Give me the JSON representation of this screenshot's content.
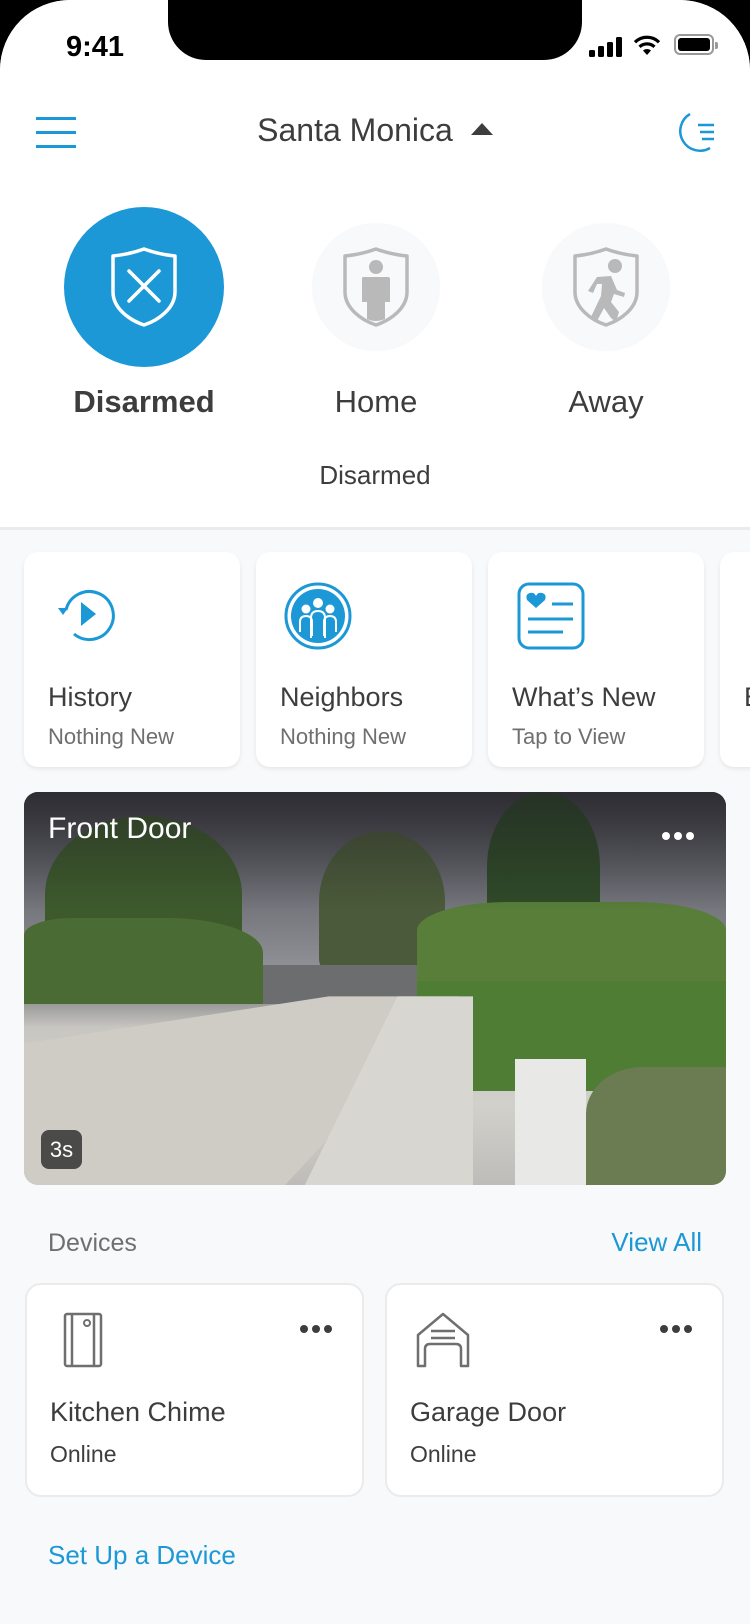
{
  "status_bar": {
    "time": "9:41",
    "icons": [
      "signal-icon",
      "wifi-icon",
      "battery-icon"
    ]
  },
  "header": {
    "location": "Santa Monica",
    "menu_icon": "hamburger-icon",
    "location_toggle_icon": "caret-up-icon",
    "mode_icon": "moon-icon"
  },
  "modes": {
    "items": [
      {
        "label": "Disarmed",
        "icon": "shield-x-icon",
        "active": true
      },
      {
        "label": "Home",
        "icon": "shield-person-icon",
        "active": false
      },
      {
        "label": "Away",
        "icon": "shield-running-icon",
        "active": false
      }
    ],
    "current_status": "Disarmed"
  },
  "features": [
    {
      "title": "History",
      "subtitle": "Nothing New",
      "icon": "history-icon"
    },
    {
      "title": "Neighbors",
      "subtitle": "Nothing New",
      "icon": "neighbors-icon"
    },
    {
      "title": "What’s New",
      "subtitle": "Tap to View",
      "icon": "whats-new-icon"
    },
    {
      "title": "E",
      "subtitle": "",
      "icon": ""
    }
  ],
  "camera": {
    "title": "Front Door",
    "age_badge": "3s",
    "more_icon": "more-icon"
  },
  "devices": {
    "heading": "Devices",
    "view_all": "View All",
    "items": [
      {
        "name": "Kitchen Chime",
        "status": "Online",
        "icon": "chime-icon"
      },
      {
        "name": "Garage Door",
        "status": "Online",
        "icon": "garage-icon"
      }
    ],
    "setup_link": "Set Up a Device"
  },
  "colors": {
    "accent": "#1c98d6",
    "text": "#3d3d3d",
    "subtext": "#6f6f6f",
    "background": "#f8f9fb",
    "inactive_icon": "#b9b9b9"
  }
}
